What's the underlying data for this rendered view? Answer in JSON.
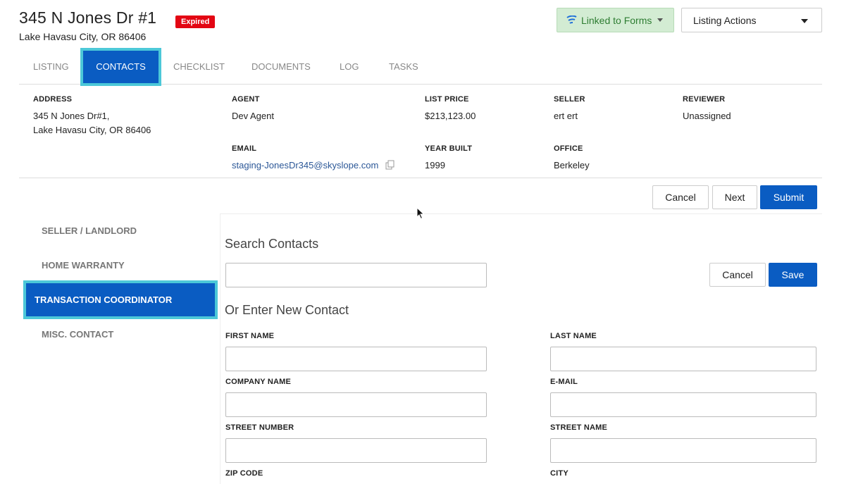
{
  "header": {
    "title": "345 N Jones Dr #1",
    "status_badge": "Expired",
    "subtitle": "Lake Havasu City, OR 86406",
    "linked_label": "Linked to Forms",
    "actions_label": "Listing Actions"
  },
  "tabs": [
    {
      "label": "LISTING"
    },
    {
      "label": "CONTACTS"
    },
    {
      "label": "CHECKLIST"
    },
    {
      "label": "DOCUMENTS"
    },
    {
      "label": "LOG"
    },
    {
      "label": "TASKS"
    }
  ],
  "info": {
    "address_label": "ADDRESS",
    "address_line1": "345 N Jones Dr#1,",
    "address_line2": "Lake Havasu City, OR 86406",
    "agent_label": "AGENT",
    "agent": "Dev Agent",
    "email_label": "EMAIL",
    "email": "staging-JonesDr345@skyslope.com",
    "list_price_label": "LIST PRICE",
    "list_price": "$213,123.00",
    "year_built_label": "YEAR BUILT",
    "year_built": "1999",
    "seller_label": "SELLER",
    "seller": "ert ert",
    "office_label": "OFFICE",
    "office": "Berkeley",
    "reviewer_label": "REVIEWER",
    "reviewer": "Unassigned"
  },
  "top_buttons": {
    "cancel": "Cancel",
    "next": "Next",
    "submit": "Submit"
  },
  "sidebar": {
    "items": [
      {
        "label": "SELLER / LANDLORD"
      },
      {
        "label": "HOME WARRANTY"
      },
      {
        "label": "TRANSACTION COORDINATOR"
      },
      {
        "label": "MISC. CONTACT"
      }
    ]
  },
  "form": {
    "search_heading": "Search Contacts",
    "search_value": "",
    "cancel": "Cancel",
    "save": "Save",
    "new_heading": "Or Enter New Contact",
    "first_name_label": "FIRST NAME",
    "last_name_label": "LAST NAME",
    "company_label": "COMPANY NAME",
    "email_label": "E-MAIL",
    "street_number_label": "STREET NUMBER",
    "street_name_label": "STREET NAME",
    "zip_label": "ZIP CODE",
    "city_label": "CITY"
  },
  "colors": {
    "primary": "#0a5cc2",
    "active_outline": "#4cc8d8",
    "badge": "#e30613",
    "linked_bg": "#d3ecd3"
  }
}
